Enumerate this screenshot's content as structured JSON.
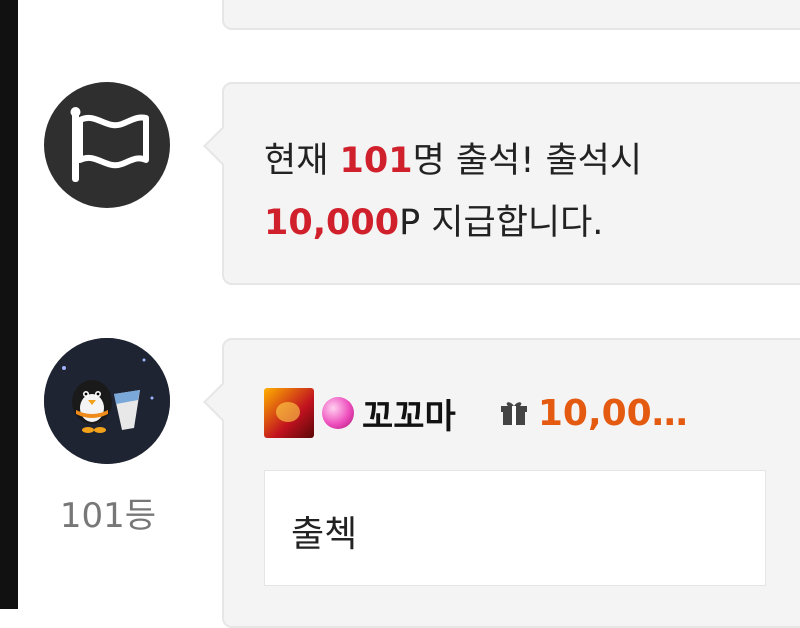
{
  "notice": {
    "prefix": "현재 ",
    "count": "101",
    "mid": "명 출석! 출석시",
    "points": "10,000",
    "suffix": "P 지급합니다."
  },
  "entry": {
    "rank": "101등",
    "username": "꼬꼬마",
    "reward": "10,00…",
    "message": "출첵"
  },
  "colors": {
    "highlight": "#d0202c",
    "reward": "#e35a10"
  },
  "icons": [
    "flag-icon",
    "level-icon",
    "gem-icon",
    "gift-icon"
  ]
}
